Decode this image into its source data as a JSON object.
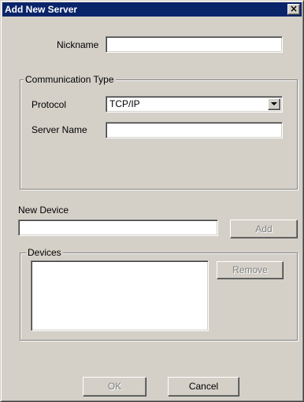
{
  "window": {
    "title": "Add New Server",
    "close_glyph": "×"
  },
  "nickname": {
    "label": "Nickname",
    "value": ""
  },
  "communication": {
    "group_label": "Communication Type",
    "protocol_label": "Protocol",
    "protocol_value": "TCP/IP",
    "server_name_label": "Server Name",
    "server_name_value": ""
  },
  "new_device": {
    "label": "New Device",
    "value": "",
    "add_label": "Add"
  },
  "devices": {
    "group_label": "Devices",
    "items": [],
    "remove_label": "Remove"
  },
  "footer": {
    "ok_label": "OK",
    "cancel_label": "Cancel"
  }
}
